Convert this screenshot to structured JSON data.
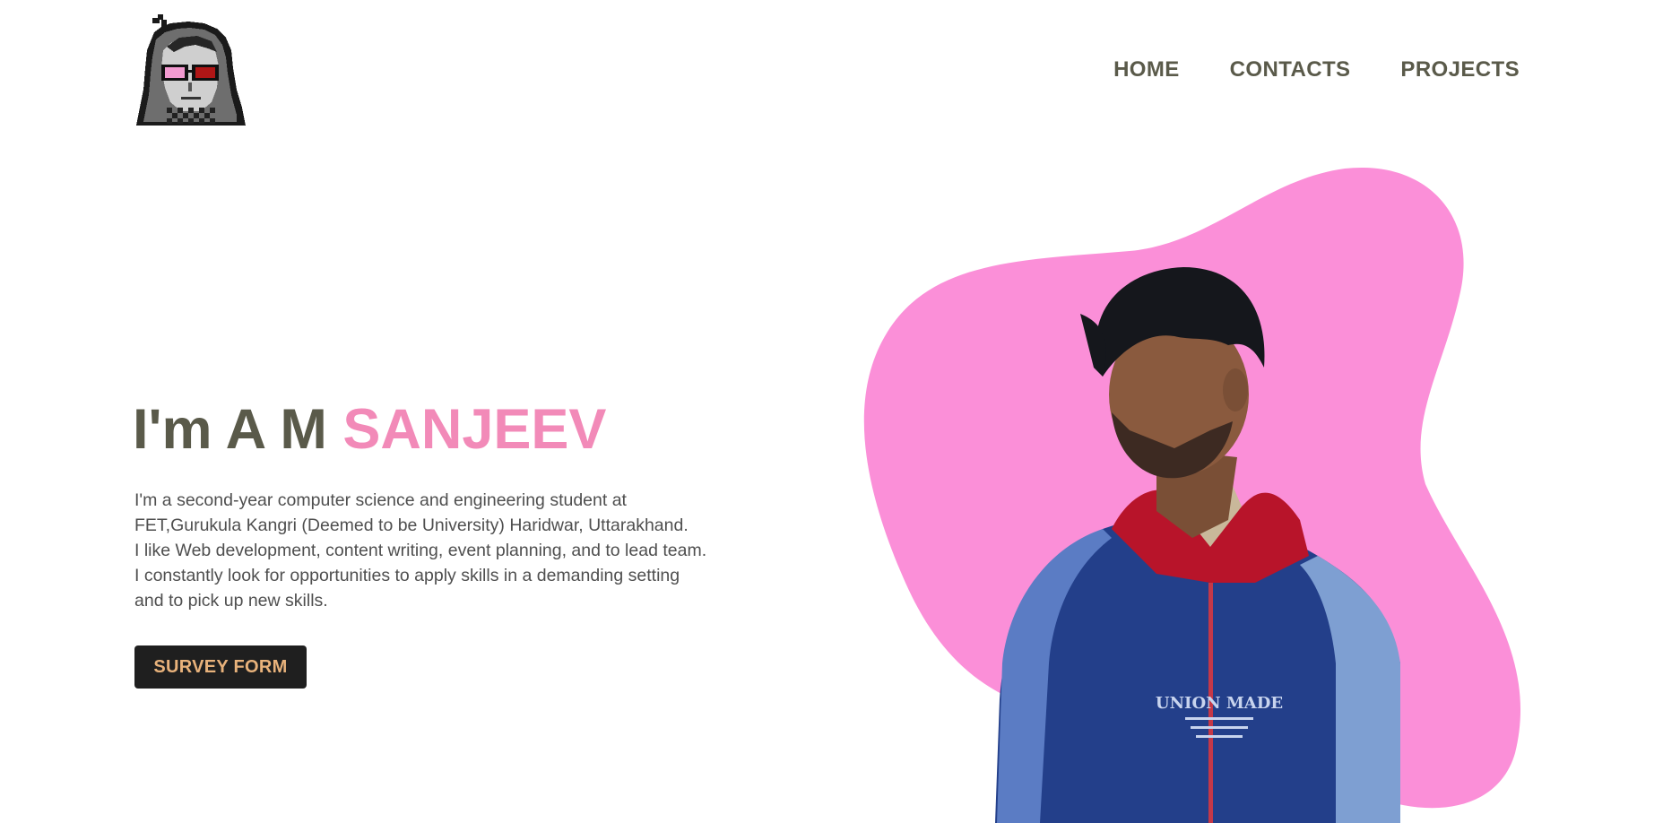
{
  "logo": {
    "icon": "pixel-avatar-hooded-face"
  },
  "nav": {
    "items": [
      {
        "label": "HOME"
      },
      {
        "label": "CONTACTS"
      },
      {
        "label": "PROJECTS"
      }
    ]
  },
  "hero": {
    "title_prefix": "I'm A M ",
    "title_name": "SANJEEV",
    "bio_lines": [
      "I'm a second-year computer science and engineering student at",
      "FET,Gurukula Kangri (Deemed to be University) Haridwar, Uttarakhand.",
      "I like Web development, content writing, event planning, and to lead team.",
      "I constantly look for opportunities to apply skills in a demanding setting",
      "and to pick up new skills."
    ],
    "cta_label": "SURVEY FORM",
    "portrait": {
      "icon": "person-portrait",
      "jacket_print": "UNION MADE"
    }
  },
  "colors": {
    "accent_pink": "#f28ab8",
    "blob_pink": "#fb8fd8",
    "text_dark": "#5a5a4a",
    "button_bg": "#1f1f1f",
    "button_text": "#e8b27b"
  }
}
